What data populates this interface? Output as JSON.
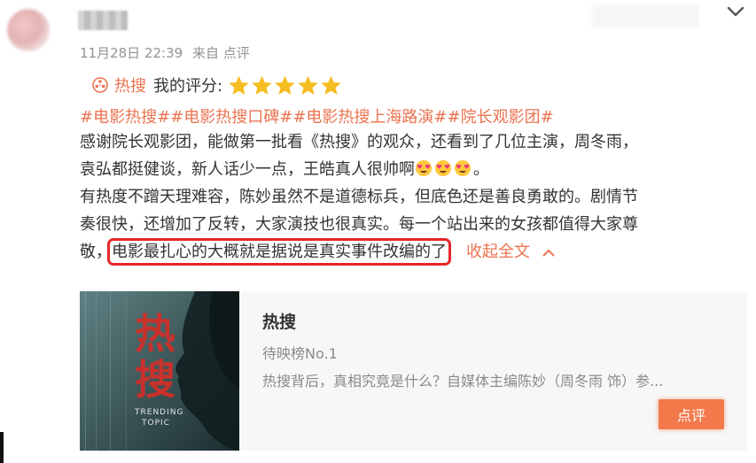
{
  "post": {
    "date": "11月28日 22:39",
    "source": "来自 点评",
    "rating": {
      "hot_link": "热搜",
      "label": "我的评分:",
      "stars": 5,
      "star_color": "#f5bd1f"
    },
    "hashtags": [
      "#电影热搜#",
      "#电影热搜口碑#",
      "#电影热搜上海路演#",
      "#院长观影团#"
    ],
    "lines": {
      "l1": "感谢院长观影团，能做第一批看《热搜》的观众，还看到了几位主演，周冬雨，",
      "l2": "袁弘都挺健谈，新人话少一点，王皓真人很帅啊",
      "l2_end": "。",
      "l3": "有热度不蹭天理难容，陈妙虽然不是道德标兵，但底色还是善良勇敢的。剧情节",
      "l4": "奏很快，还增加了反转，大家演技也很真实。每一个站出来的女孩都值得大家尊",
      "l5_start": "敬，",
      "l5_highlight": "电影最扎心的大概就是据说是真实事件改编的了",
      "collapse": "收起全文"
    },
    "accent": "#eb7350",
    "highlight_color": "#e6262a"
  },
  "card": {
    "title": "热搜",
    "subtitle": "待映榜No.1",
    "description": "热搜背后，真相究竟是什么？自媒体主编陈妙（周冬雨 饰）参...",
    "button": "点评",
    "poster": {
      "title_cn": "热搜",
      "title_en_1": "TRENDING",
      "title_en_2": "TOPIC"
    }
  }
}
